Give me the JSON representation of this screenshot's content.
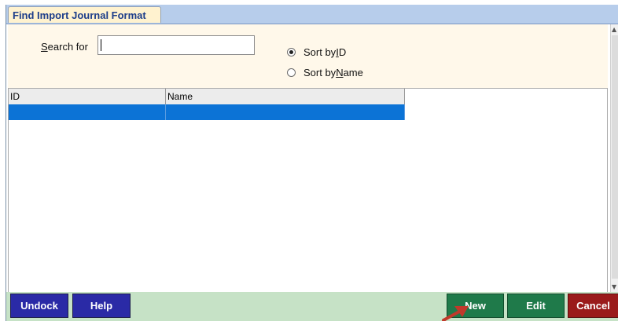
{
  "window": {
    "tab_title": "Find Import Journal Format"
  },
  "search": {
    "label_first": "S",
    "label_rest": "earch for",
    "value": "",
    "sort_options": [
      {
        "prefix": "Sort by ",
        "key": "I",
        "suffix": "D",
        "selected": true
      },
      {
        "prefix": "Sort by ",
        "key": "N",
        "suffix": "ame",
        "selected": false
      }
    ]
  },
  "grid": {
    "columns": [
      "ID",
      "Name"
    ],
    "rows": [
      {
        "ID": "",
        "Name": "",
        "selected": true
      }
    ]
  },
  "footer": {
    "undock": "Undock",
    "help": "Help",
    "new": "New",
    "edit": "Edit",
    "cancel": "Cancel"
  },
  "colors": {
    "tab_bg": "#fff2cf",
    "title_bar": "#b7cdeb",
    "selection": "#0c73d6",
    "footer_bg": "#c6e2c6",
    "btn_blue": "#2a2aa6",
    "btn_green": "#1f7a4a",
    "btn_red": "#9a1b1b",
    "annotation_arrow": "#c0392b"
  }
}
